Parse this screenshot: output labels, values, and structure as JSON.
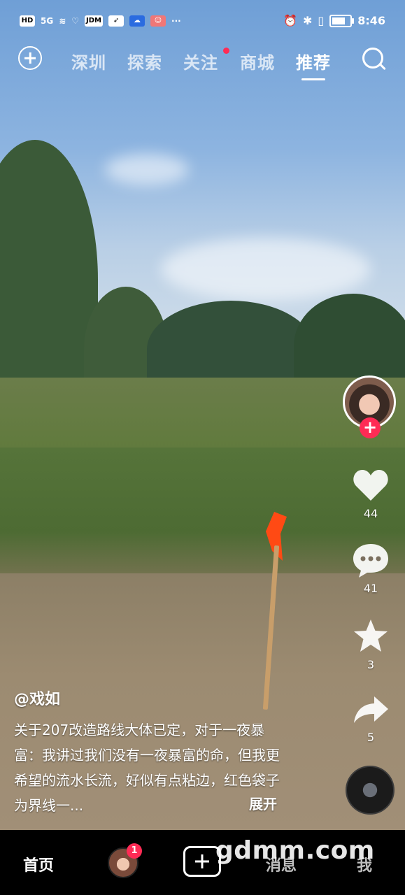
{
  "status_bar": {
    "left_items": [
      "HD",
      "5G",
      "JDM"
    ],
    "time": "8:46",
    "battery_level": 0.75
  },
  "top_tabs": {
    "items": [
      "深圳",
      "探索",
      "关注",
      "商城",
      "推荐"
    ],
    "active": "推荐",
    "dot_on": "关注"
  },
  "rail": {
    "like_count": "44",
    "comment_count": "41",
    "favorite_count": "3",
    "share_count": "5",
    "follow_symbol": "+"
  },
  "post": {
    "author": "@戏如",
    "caption": "关于207改造路线大体已定，对于一夜暴富：我讲过我们没有一夜暴富的命，但我更希望的流水长流，好似有点粘边，红色袋子为界线一...",
    "expand_label": "展开"
  },
  "bottom_nav": {
    "home": "首页",
    "friends_badge": "1",
    "messages": "消息",
    "me": "我"
  },
  "watermark": "gdmm.com",
  "colors": {
    "accent": "#ff2b55",
    "flag": "#ff4a14"
  }
}
